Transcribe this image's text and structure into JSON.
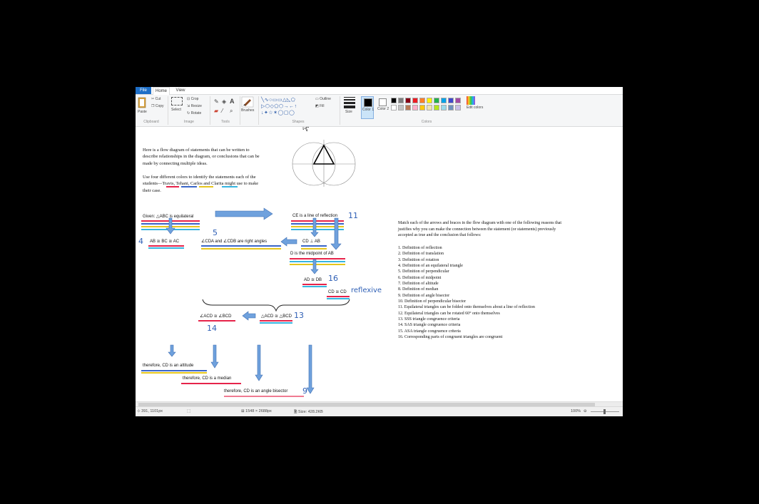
{
  "tabs": {
    "file": "File",
    "home": "Home",
    "view": "View"
  },
  "ribbon": {
    "clipboard": {
      "label": "Clipboard",
      "paste": "Paste",
      "cut": "Cut",
      "copy": "Copy"
    },
    "image": {
      "label": "Image",
      "select": "Select",
      "crop": "Crop",
      "resize": "Resize",
      "rotate": "Rotate"
    },
    "tools": {
      "label": "Tools"
    },
    "brushes": {
      "label": "Brushes"
    },
    "shapes": {
      "label": "Shapes",
      "outline": "Outline",
      "fill": "Fill"
    },
    "size": {
      "label": "Size"
    },
    "color1": "Color 1",
    "color2": "Color 2",
    "colors": {
      "label": "Colors",
      "edit": "Edit colors"
    },
    "palette_row1": [
      "#000000",
      "#7f7f7f",
      "#880015",
      "#ed1c24",
      "#ff7f27",
      "#fff200",
      "#22b14c",
      "#00a2e8",
      "#3f48cc",
      "#a349a4"
    ],
    "palette_row2": [
      "#ffffff",
      "#c3c3c3",
      "#b97a57",
      "#ffaec9",
      "#ffc90e",
      "#efe4b0",
      "#b5e61d",
      "#99d9ea",
      "#7092be",
      "#c8bfe7"
    ]
  },
  "canvas": {
    "intro_lines": [
      "Here is a flow diagram of statements that can be written to",
      "describe relationships in the diagram, or conclusions that can be",
      "made by connecting multiple ideas."
    ],
    "use_lines": [
      "Use four different colors to identify the statements each of the",
      "students—Travis, Tehani, Carlos and Clarita might use to make",
      "their case."
    ],
    "flow": {
      "given": "Given: △ABC is equilateral",
      "line_reflection": "CE is a line of reflection",
      "ab_bc_ac": "AB ≅ BC ≅ AC",
      "right_angles": "∠CDA  and  ∠CDB  are right angles",
      "perp": "CD ⊥ AB",
      "midpoint": "D is the midpoint of AB",
      "ad_db": "AD ≅ DB",
      "cd_cd": "CD ≅ CD",
      "angles_cong": "∠ACD ≅ ∠BCD",
      "triangles_cong": "△ACD ≅ △BCD",
      "altitude": "therefore, CD is an altitude",
      "median": "therefore, CD is a median",
      "bisector": "therefore, CD is an angle bisector"
    },
    "handwriting": {
      "n11": "11",
      "n4": "4",
      "n5": "5",
      "n16": "16",
      "reflexive": "reflexive",
      "n13": "13",
      "n14": "14",
      "n9": "9"
    },
    "match_lines": [
      "Match each of the arrows and braces in the flow diagram with one of the following reasons that",
      "justifies why you can make the connection between the statement (or statements) previously",
      "accepted as true and the conclusion that follows:"
    ],
    "reasons": [
      "1.    Definition of reflection",
      "2.    Definition of translation",
      "3.    Definition of rotation",
      "4.    Definition of an equilateral triangle",
      "5.    Definition of perpendicular",
      "6.    Definition of midpoint",
      "7.    Definition of altitude",
      "8.    Definition of median",
      "9.    Definition of angle bisector",
      "10.  Definition of perpendicular bisector",
      "11.  Equilateral triangles can be folded onto themselves about a line of reflection",
      "12.  Equilateral triangles can be rotated 60° onto themselves",
      "13.  SSS triangle congruence criteria",
      "14.  SAS triangle congruence criteria",
      "15.  ASA triangle congruence criteria",
      "16.  Corresponding parts of congruent triangles are congruent"
    ]
  },
  "status": {
    "cursor": "391, 1101px",
    "dimensions": "1548 × 2688px",
    "size": "Size: 428.2KB",
    "zoom": "100%"
  }
}
